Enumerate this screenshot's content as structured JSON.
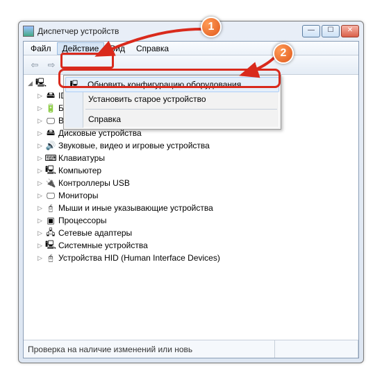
{
  "window": {
    "title": "Диспетчер устройств"
  },
  "menubar": {
    "file": "Файл",
    "action": "Действие",
    "view": "Вид",
    "help": "Справка"
  },
  "dropdown": {
    "scan": "Обновить конфигурацию оборудования",
    "legacy": "Установить старое устройство",
    "help": "Справка"
  },
  "tree": {
    "root": "",
    "items": [
      {
        "label": "IDE ATA/ATAPI контроллеры",
        "icon": "🖴"
      },
      {
        "label": "Батареи",
        "icon": "🔋"
      },
      {
        "label": "Видеоадаптеры",
        "icon": "🖵"
      },
      {
        "label": "Дисковые устройства",
        "icon": "🖴"
      },
      {
        "label": "Звуковые, видео и игровые устройства",
        "icon": "🔊"
      },
      {
        "label": "Клавиатуры",
        "icon": "⌨"
      },
      {
        "label": "Компьютер",
        "icon": "🖳"
      },
      {
        "label": "Контроллеры USB",
        "icon": "🔌"
      },
      {
        "label": "Мониторы",
        "icon": "🖵"
      },
      {
        "label": "Мыши и иные указывающие устройства",
        "icon": "🖯"
      },
      {
        "label": "Процессоры",
        "icon": "▣"
      },
      {
        "label": "Сетевые адаптеры",
        "icon": "🖧"
      },
      {
        "label": "Системные устройства",
        "icon": "🖳"
      },
      {
        "label": "Устройства HID (Human Interface Devices)",
        "icon": "🖰"
      }
    ]
  },
  "statusbar": {
    "text": "Проверка на наличие изменений или новь"
  },
  "callouts": {
    "one": "1",
    "two": "2"
  },
  "winbtn": {
    "min": "—",
    "max": "☐",
    "close": "✕"
  }
}
